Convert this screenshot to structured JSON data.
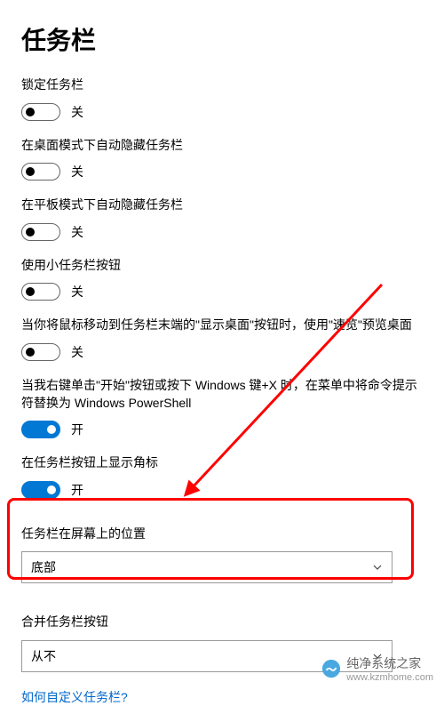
{
  "title": "任务栏",
  "settings": {
    "lock": {
      "label": "锁定任务栏",
      "state": "关"
    },
    "autohide_desktop": {
      "label": "在桌面模式下自动隐藏任务栏",
      "state": "关"
    },
    "autohide_tablet": {
      "label": "在平板模式下自动隐藏任务栏",
      "state": "关"
    },
    "small_buttons": {
      "label": "使用小任务栏按钮",
      "state": "关"
    },
    "peek": {
      "label": "当你将鼠标移动到任务栏末端的\"显示桌面\"按钮时，使用\"速览\"预览桌面",
      "state": "关"
    },
    "powershell": {
      "label": "当我右键单击\"开始\"按钮或按下 Windows 键+X 时，在菜单中将命令提示符替换为 Windows PowerShell",
      "state": "开"
    },
    "badges": {
      "label": "在任务栏按钮上显示角标",
      "state": "开"
    },
    "position": {
      "label": "任务栏在屏幕上的位置",
      "value": "底部"
    },
    "combine": {
      "label": "合并任务栏按钮",
      "value": "从不"
    }
  },
  "link": "如何自定义任务栏?",
  "watermark": {
    "text": "纯净系统之家",
    "url": "www.kzmhome.com"
  }
}
